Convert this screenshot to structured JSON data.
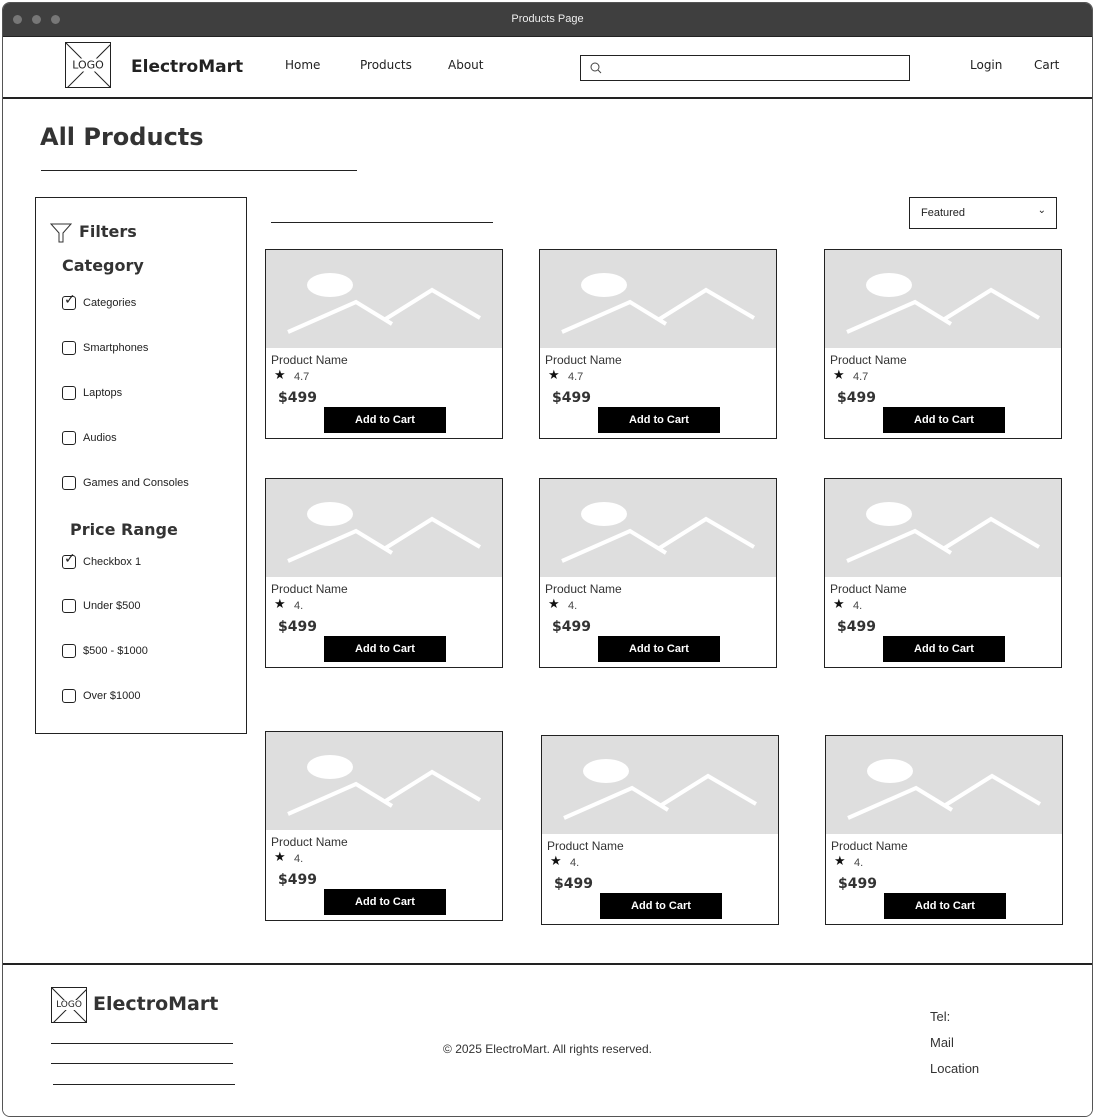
{
  "window": {
    "title": "Products Page"
  },
  "nav": {
    "logo_text": "LOGO",
    "brand": "ElectroMart",
    "links": [
      "Home",
      "Products",
      "About"
    ],
    "search_placeholder": "",
    "login": "Login",
    "cart": "Cart"
  },
  "main": {
    "title": "All Products"
  },
  "filters": {
    "heading": "Filters",
    "category_heading": "Category",
    "categories": [
      {
        "label": "Categories",
        "checked": true
      },
      {
        "label": "Smartphones",
        "checked": false
      },
      {
        "label": "Laptops",
        "checked": false
      },
      {
        "label": "Audios",
        "checked": false
      },
      {
        "label": "Games and Consoles",
        "checked": false
      }
    ],
    "price_heading": "Price Range",
    "prices": [
      {
        "label": "Checkbox 1",
        "checked": true
      },
      {
        "label": "Under $500",
        "checked": false
      },
      {
        "label": "$500 - $1000",
        "checked": false
      },
      {
        "label": "Over $1000",
        "checked": false
      }
    ]
  },
  "sort": {
    "selected": "Featured"
  },
  "products": [
    {
      "name": "Product Name",
      "rating": "4.7",
      "price": "$499",
      "button": "Add to Cart"
    },
    {
      "name": "Product Name",
      "rating": "4.7",
      "price": "$499",
      "button": "Add to Cart"
    },
    {
      "name": "Product Name",
      "rating": "4.7",
      "price": "$499",
      "button": "Add to Cart"
    },
    {
      "name": "Product Name",
      "rating": "4.",
      "price": "$499",
      "button": "Add to Cart"
    },
    {
      "name": "Product Name",
      "rating": "4.",
      "price": "$499",
      "button": "Add to Cart"
    },
    {
      "name": "Product Name",
      "rating": "4.",
      "price": "$499",
      "button": "Add to Cart"
    },
    {
      "name": "Product Name",
      "rating": "4.",
      "price": "$499",
      "button": "Add to Cart"
    },
    {
      "name": "Product Name",
      "rating": "4.",
      "price": "$499",
      "button": "Add to Cart"
    },
    {
      "name": "Product Name",
      "rating": "4.",
      "price": "$499",
      "button": "Add to Cart"
    }
  ],
  "footer": {
    "logo_text": "LOGO",
    "brand": "ElectroMart",
    "copyright": "© 2025 ElectroMart. All rights reserved.",
    "tel": "Tel:",
    "mail": "Mail",
    "location": "Location"
  }
}
